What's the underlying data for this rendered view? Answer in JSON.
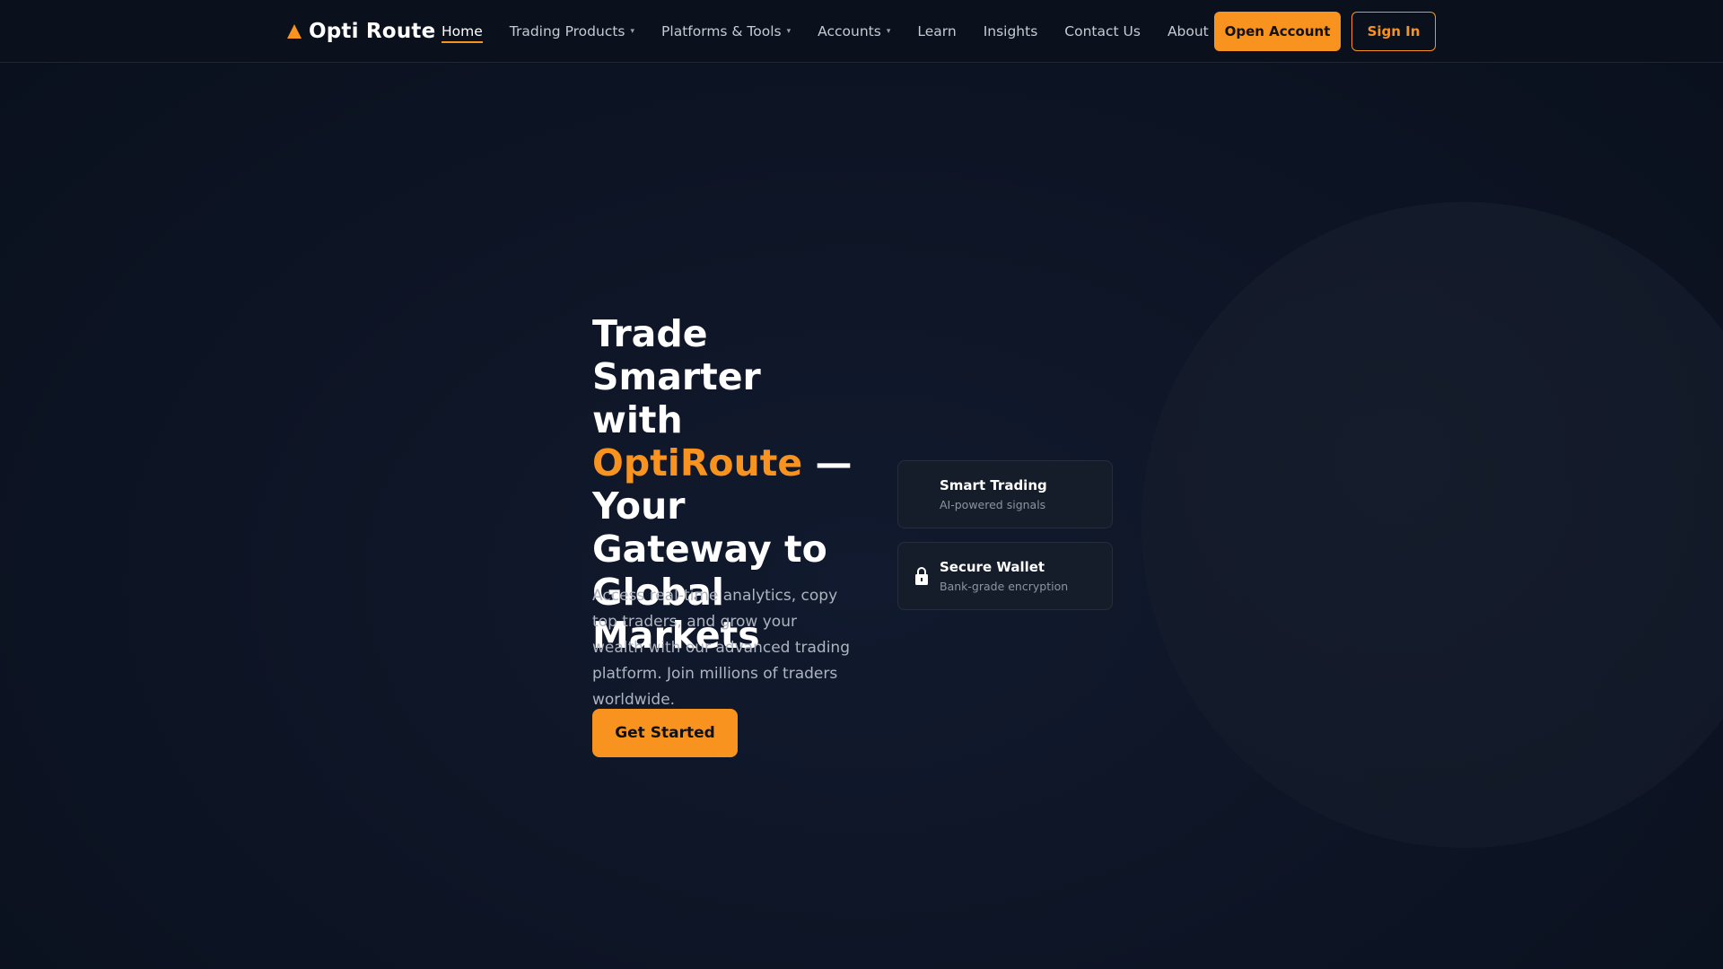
{
  "brand": {
    "logo_text": "Opti Route",
    "accent_color": "#f7931e"
  },
  "nav": {
    "items": [
      {
        "label": "Home",
        "active": true,
        "has_dropdown": false
      },
      {
        "label": "Trading Products",
        "active": false,
        "has_dropdown": true
      },
      {
        "label": "Platforms & Tools",
        "active": false,
        "has_dropdown": true
      },
      {
        "label": "Accounts",
        "active": false,
        "has_dropdown": true
      },
      {
        "label": "Learn",
        "active": false,
        "has_dropdown": false
      },
      {
        "label": "Insights",
        "active": false,
        "has_dropdown": false
      },
      {
        "label": "Contact Us",
        "active": false,
        "has_dropdown": false
      },
      {
        "label": "About Us",
        "active": false,
        "has_dropdown": false
      }
    ],
    "caret": "▾"
  },
  "header": {
    "open_account_label": "Open Account",
    "sign_in_label": "Sign In"
  },
  "hero": {
    "title_part1": "Trade Smarter with ",
    "title_accent": "OptiRoute",
    "title_part2": " — Your Gateway to Global Markets",
    "description": "Access real-time analytics, copy top traders, and grow your wealth with our advanced trading platform. Join millions of traders worldwide.",
    "cta_label": "Get Started"
  },
  "features": [
    {
      "title": "Smart Trading",
      "subtitle": "AI-powered signals",
      "icon": "none"
    },
    {
      "title": "Secure Wallet",
      "subtitle": "Bank-grade encryption",
      "icon": "lock-icon"
    }
  ]
}
